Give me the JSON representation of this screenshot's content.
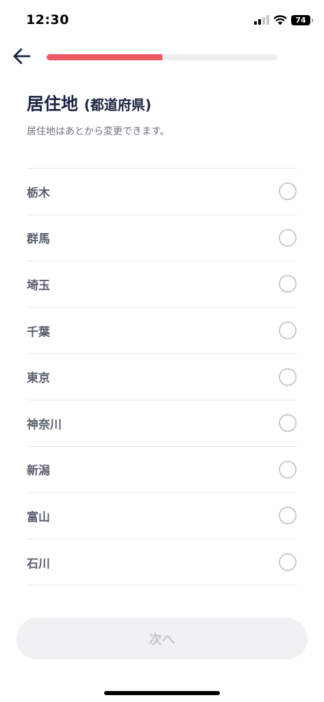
{
  "status_bar": {
    "time": "12:30",
    "battery": "74",
    "signal_bars_active": 2,
    "signal_bars_total": 4
  },
  "header": {
    "back_icon": "arrow-left-icon",
    "progress_fraction": 0.5
  },
  "title": {
    "main": "居住地",
    "suffix": "(都道府県)"
  },
  "subtitle": "居住地はあとから変更できます。",
  "prefectures": [
    {
      "label": "栃木",
      "selected": false
    },
    {
      "label": "群馬",
      "selected": false
    },
    {
      "label": "埼玉",
      "selected": false
    },
    {
      "label": "千葉",
      "selected": false
    },
    {
      "label": "東京",
      "selected": false
    },
    {
      "label": "神奈川",
      "selected": false
    },
    {
      "label": "新潟",
      "selected": false
    },
    {
      "label": "富山",
      "selected": false
    },
    {
      "label": "石川",
      "selected": false
    }
  ],
  "next_button": {
    "label": "次へ",
    "enabled": false
  },
  "colors": {
    "accent": "#ee5a67",
    "title": "#1a2340",
    "disabled_text": "#c3c4c9"
  }
}
